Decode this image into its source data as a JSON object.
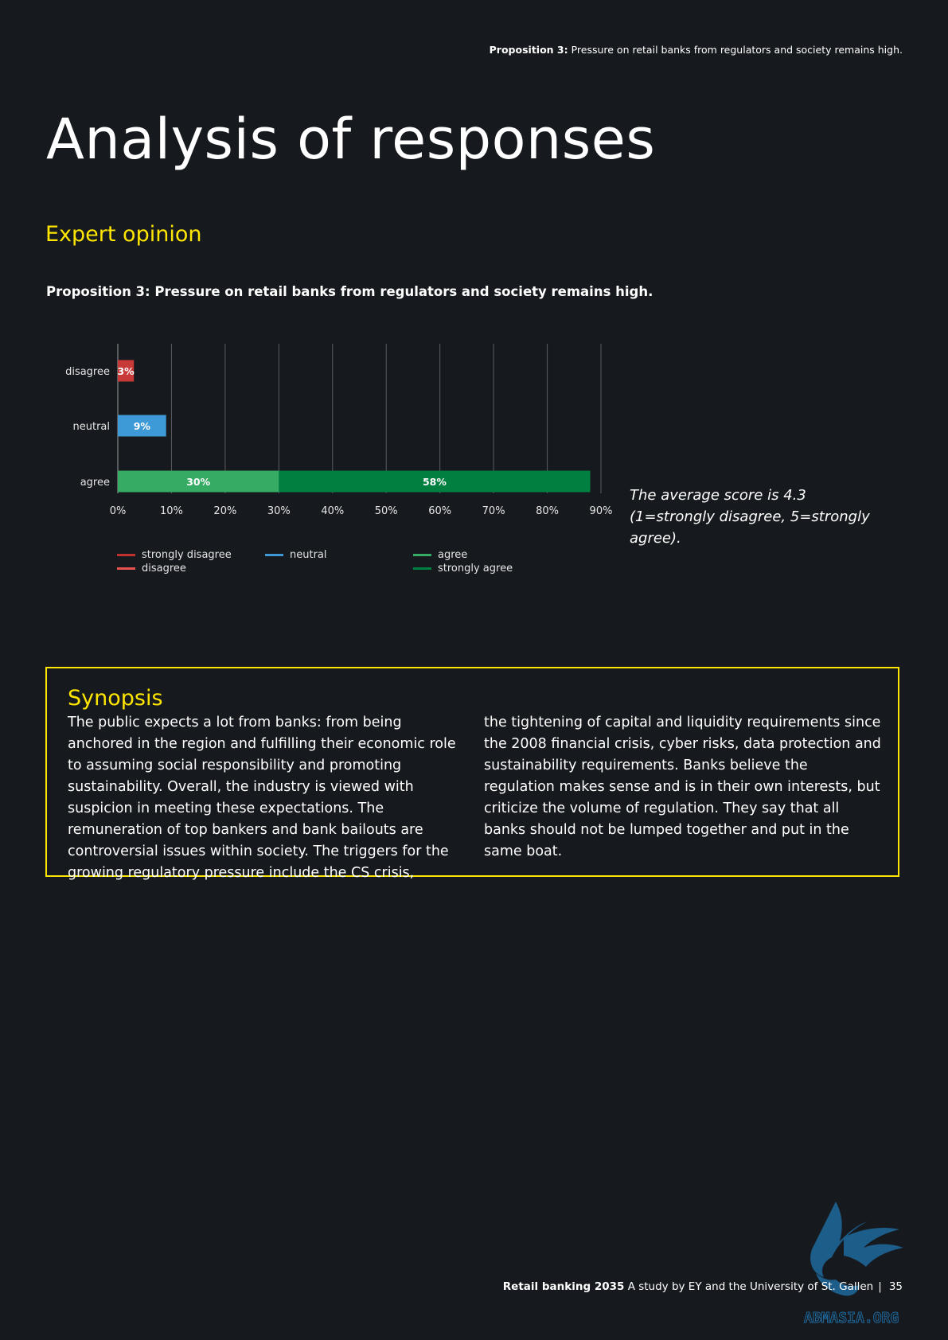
{
  "header": {
    "proposition_label": "Proposition 3:",
    "proposition_text": " Pressure on retail banks from regulators and society remains high."
  },
  "page_title": "Analysis of responses",
  "section_heading": "Expert opinion",
  "chart_title": "Proposition 3: Pressure on retail banks from regulators and society remains high.",
  "chart_data": {
    "type": "bar",
    "orientation": "horizontal",
    "stacked": true,
    "categories": [
      "disagree",
      "neutral",
      "agree"
    ],
    "series": [
      {
        "name": "strongly disagree",
        "color": "#c0302f",
        "values": [
          0,
          0,
          0
        ]
      },
      {
        "name": "disagree",
        "color": "#c83a37",
        "values": [
          3,
          0,
          0
        ]
      },
      {
        "name": "neutral",
        "color": "#3d9ad6",
        "values": [
          0,
          9,
          0
        ]
      },
      {
        "name": "agree",
        "color": "#35ab63",
        "values": [
          0,
          0,
          30
        ]
      },
      {
        "name": "strongly agree",
        "color": "#008040",
        "values": [
          0,
          0,
          58
        ]
      }
    ],
    "data_labels": [
      {
        "category": "disagree",
        "series": "disagree",
        "label": "3%"
      },
      {
        "category": "neutral",
        "series": "neutral",
        "label": "9%"
      },
      {
        "category": "agree",
        "series": "agree",
        "label": "30%"
      },
      {
        "category": "agree",
        "series": "strongly agree",
        "label": "58%"
      }
    ],
    "xticks": [
      "0%",
      "10%",
      "20%",
      "30%",
      "40%",
      "50%",
      "60%",
      "70%",
      "80%",
      "90%"
    ],
    "xlim": [
      0,
      90
    ],
    "grid": true,
    "legend_placement": "bottom",
    "legend": [
      {
        "label": "strongly disagree",
        "color": "#c0302f"
      },
      {
        "label": "disagree",
        "color": "#e8524f"
      },
      {
        "label": "neutral",
        "color": "#3d9ad6"
      },
      {
        "label": "agree",
        "color": "#35ab63"
      },
      {
        "label": "strongly agree",
        "color": "#008040"
      }
    ]
  },
  "average_note": "The average score is 4.3 (1=strongly disagree, 5=strongly agree).",
  "synopsis": {
    "heading": "Synopsis",
    "col1": "The public expects a lot from banks: from being anchored in the region and fulfilling their economic role to assuming social responsibility and promoting sustainability. Overall, the industry is viewed with suspicion in meeting these expectations. The remuneration of top bankers and bank bailouts are controversial issues within society. The triggers for the growing regulatory pressure include the CS crisis,",
    "col2": "the tightening of capital and liquidity requirements since the 2008 financial crisis, cyber risks, data protection and sustainability requirements. Banks believe the regulation makes sense and is in their own interests, but criticize the volume of regulation. They say that all banks should not be lumped together and put in the same boat."
  },
  "footer": {
    "title": "Retail banking 2035",
    "subtitle": "A study by EY and the University of St. Gallen",
    "separator": "|",
    "page_number": "35"
  },
  "watermark": {
    "text": "ABMASIA.ORG",
    "icon": "griffin-logo-icon",
    "color": "#1f6a9e"
  }
}
